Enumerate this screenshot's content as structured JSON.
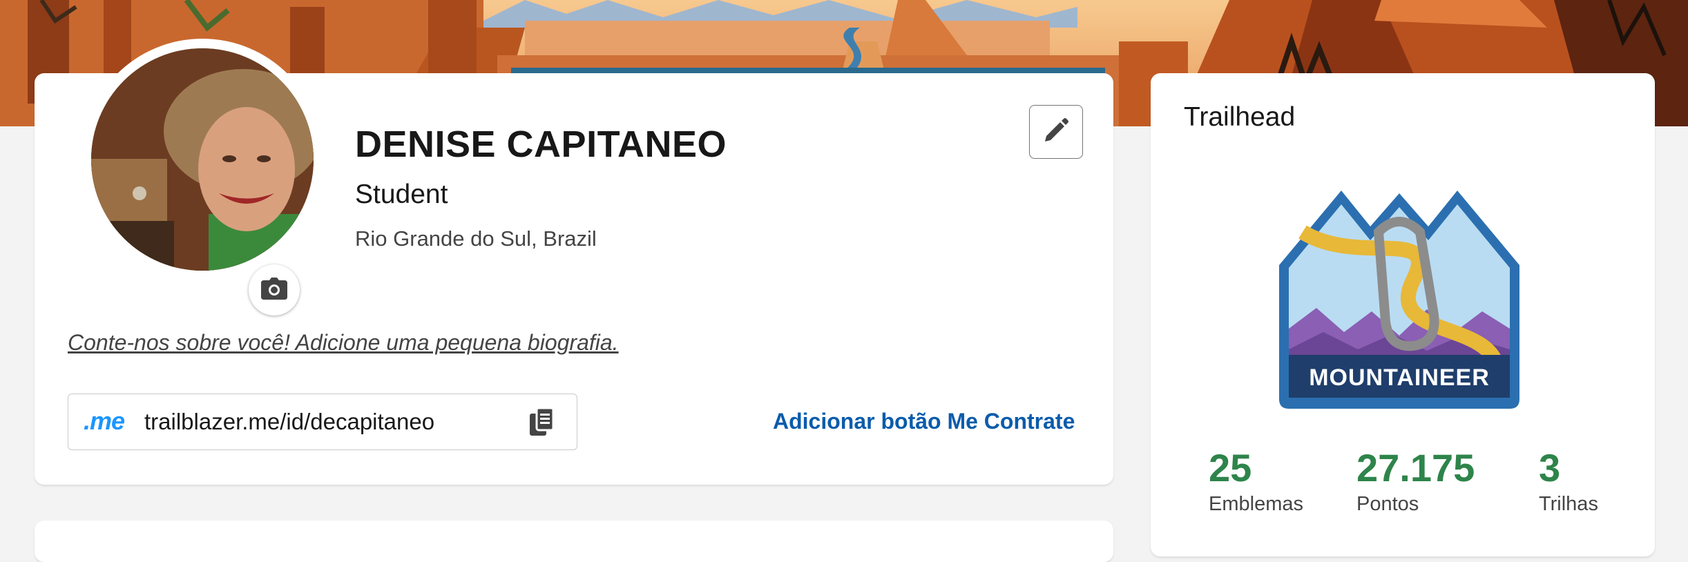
{
  "profile": {
    "name": "DENISE CAPITANEO",
    "role": "Student",
    "location": "Rio Grande do Sul, Brazil",
    "bio_prompt": "Conte-nos sobre você! Adicione uma pequena biografia.",
    "me_logo": ".me",
    "profile_url": "trailblazer.me/id/decapitaneo",
    "hire_me_label": "Adicionar botão Me Contrate",
    "icons": {
      "edit": "pencil-icon",
      "camera": "camera-icon",
      "copy": "copy-icon"
    }
  },
  "trailhead": {
    "title": "Trailhead",
    "rank_badge": "MOUNTAINEER",
    "stats": [
      {
        "value": "25",
        "label": "Emblemas"
      },
      {
        "value": "27.175",
        "label": "Pontos"
      },
      {
        "value": "3",
        "label": "Trilhas"
      }
    ]
  },
  "colors": {
    "accent_link": "#0b5cab",
    "stat_green": "#2e844a",
    "me_blue": "#1b96ff",
    "badge_navy": "#1f3e6b"
  }
}
